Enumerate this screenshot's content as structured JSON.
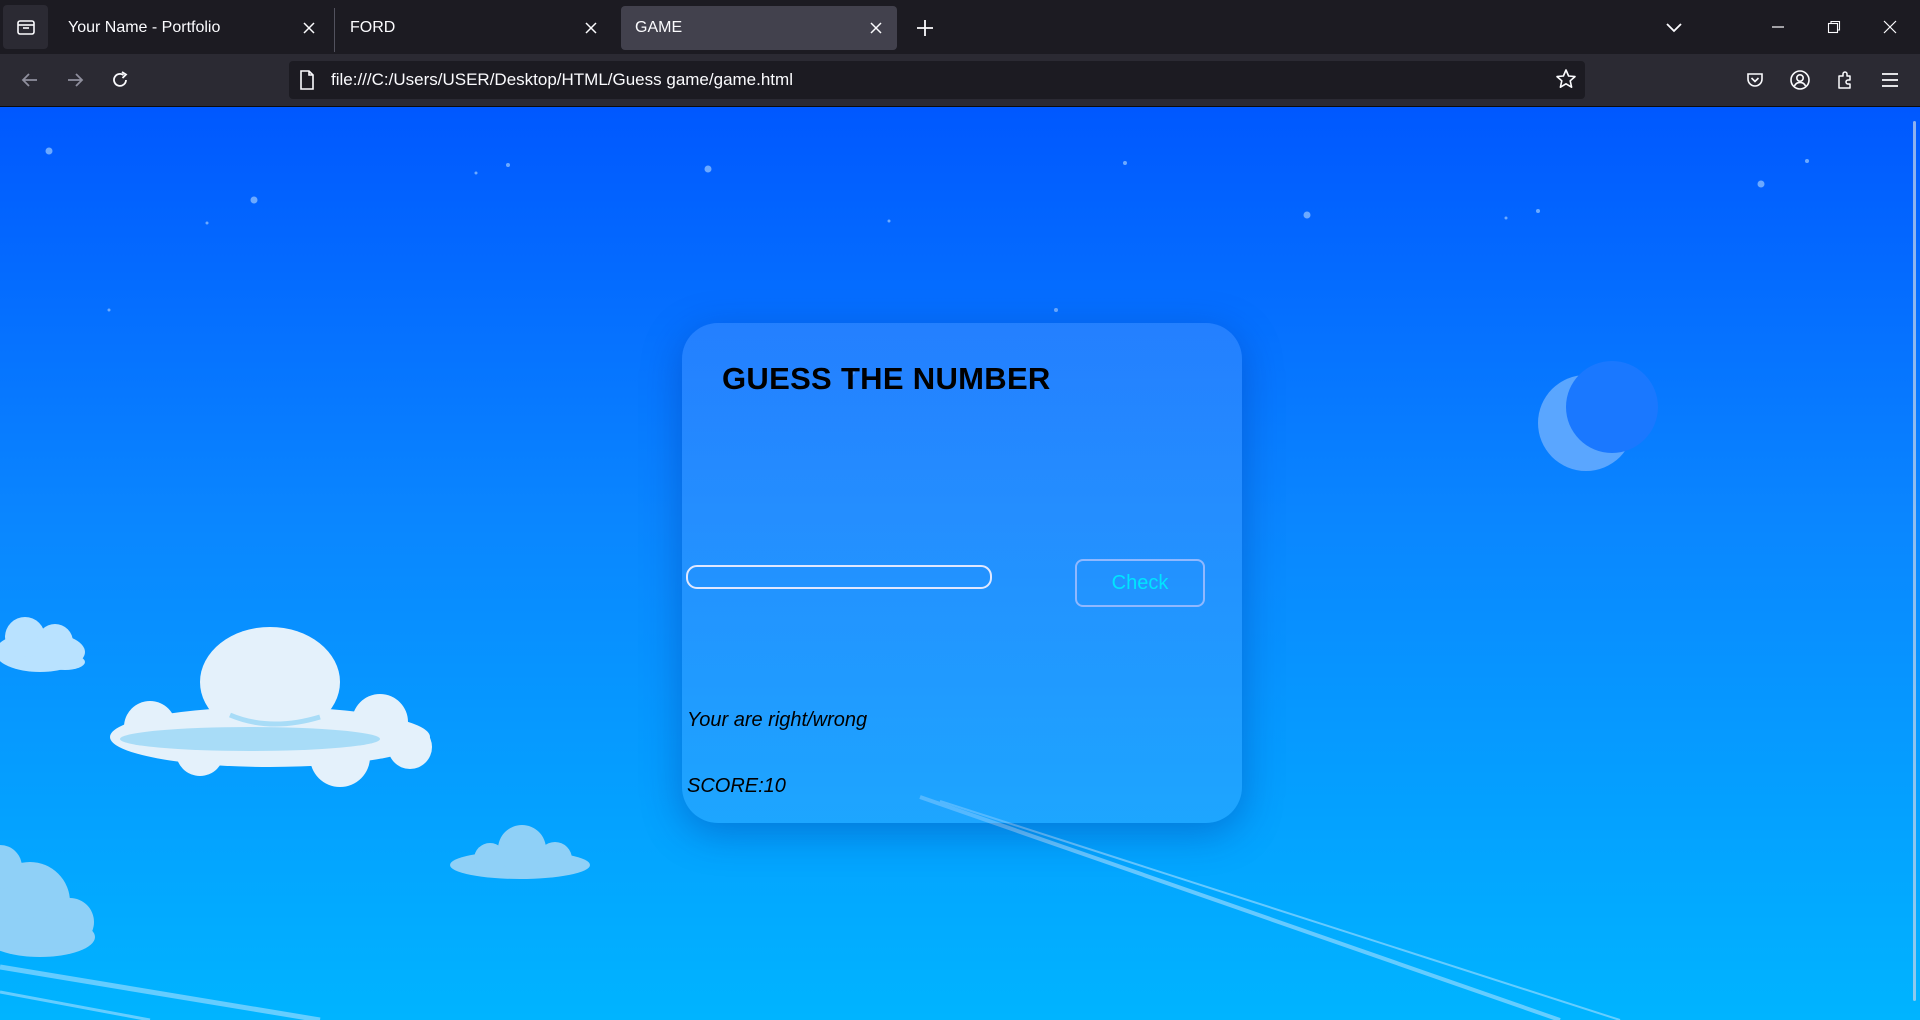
{
  "tabs": [
    {
      "label": "Your Name - Portfolio",
      "active": false
    },
    {
      "label": "FORD",
      "active": false
    },
    {
      "label": "GAME",
      "active": true
    }
  ],
  "address_bar": {
    "url": "file:///C:/Users/USER/Desktop/HTML/Guess game/game.html"
  },
  "game": {
    "title": "GUESS THE NUMBER",
    "guess_input_value": "",
    "check_label": "Check",
    "message": "Your are right/wrong",
    "score": "SCORE:10"
  },
  "colors": {
    "sky_top": "#0058ff",
    "sky_bottom": "#00b4ff",
    "check_text": "#00e5ff",
    "browser_chrome": "#1c1b22"
  },
  "icons": [
    "tab-list-icon",
    "close-icon",
    "plus-icon",
    "chevron-down-icon",
    "minimize-icon",
    "restore-icon",
    "window-close-icon",
    "back-arrow-icon",
    "forward-arrow-icon",
    "reload-icon",
    "page-icon",
    "bookmark-star-icon",
    "pocket-icon",
    "account-icon",
    "extensions-icon",
    "menu-icon",
    "moon-icon",
    "cloud-icon",
    "star-dot-icon"
  ]
}
